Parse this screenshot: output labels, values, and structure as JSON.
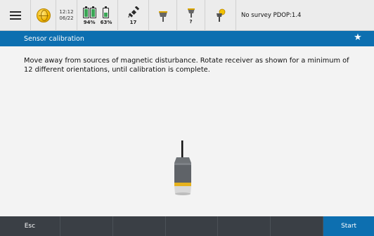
{
  "statusbar": {
    "menu_icon": "hamburger-icon",
    "globe_icon": "globe-icon",
    "time": "12:12",
    "date": "06/22",
    "battery1_percent": "94%",
    "battery2_percent": "63%",
    "battery1_level": 94,
    "battery2_level": 63,
    "satellite_count": "17",
    "receiver_status_label": "?",
    "survey_status": "No survey  PDOP:1.4",
    "battery_color": "#3aa655"
  },
  "titlebar": {
    "title": "Sensor calibration",
    "star_icon": "star-icon",
    "color": "#0d6fb0"
  },
  "content": {
    "instructions": "Move away from sources of magnetic disturbance. Rotate receiver as shown for a minimum of 12 different orientations, until calibration is complete."
  },
  "bottombar": {
    "esc_label": "Esc",
    "start_label": "Start",
    "background": "#3a3f45"
  }
}
